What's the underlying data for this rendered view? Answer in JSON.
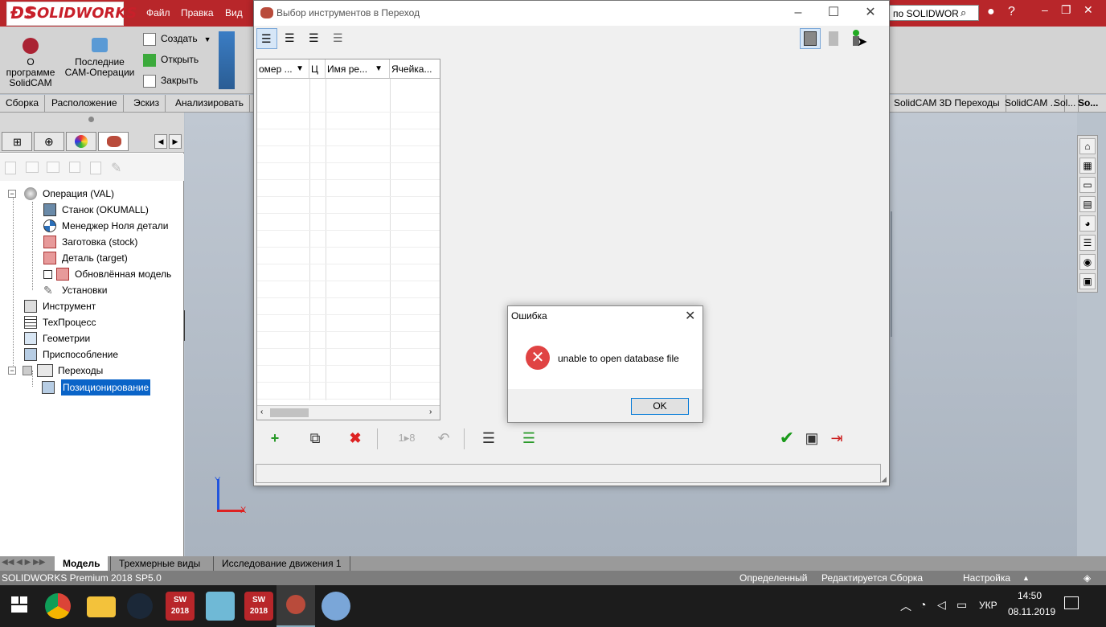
{
  "app": {
    "logo_text": "SOLIDWORKS",
    "menu": [
      "Файл",
      "Правка",
      "Вид"
    ],
    "search_text": "по SOLIDWOR",
    "brand_color": "#b8262a"
  },
  "ribbon": {
    "about_label": "О программе SolidCAM",
    "recent_label": "Последние CAM-Операции",
    "create_label": "Создать",
    "open_label": "Открыть",
    "close_label": "Закрыть"
  },
  "ribbon_tabs": [
    "Сборка",
    "Расположение",
    "Эскиз",
    "Анализировать"
  ],
  "ribbon_tabs_right": [
    "SolidCAM 3D Переходы",
    "SolidCAM ...",
    "Sol...",
    "So..."
  ],
  "tree": [
    {
      "label": "Операция (VAL)",
      "icon": "operation-icon"
    },
    {
      "label": "Станок (OKUMALL)",
      "icon": "machine-icon"
    },
    {
      "label": "Менеджер Ноля детали",
      "icon": "coordinate-icon"
    },
    {
      "label": "Заготовка (stock)",
      "icon": "stock-icon"
    },
    {
      "label": "Деталь (target)",
      "icon": "target-icon"
    },
    {
      "label": "Обновлённая модель",
      "icon": "model-icon"
    },
    {
      "label": "Установки",
      "icon": "settings-icon"
    },
    {
      "label": "Инструмент",
      "icon": "tool-icon"
    },
    {
      "label": "ТехПроцесс",
      "icon": "process-icon"
    },
    {
      "label": "Геометрии",
      "icon": "geometry-icon"
    },
    {
      "label": "Приспособление",
      "icon": "fixture-icon"
    },
    {
      "label": "Переходы",
      "icon": "folder-icon"
    },
    {
      "label": "Позиционирование",
      "icon": "position-icon"
    }
  ],
  "dialog": {
    "title": "Выбор инструментов в Переход",
    "columns": [
      "омер ...",
      "Ц",
      "Имя ре...",
      "Ячейка..."
    ]
  },
  "error": {
    "title": "Ошибка",
    "message": "unable to open database file",
    "ok_label": "OK"
  },
  "axes": {
    "y": "Y",
    "x": "X"
  },
  "bottom_tabs": [
    "Модель",
    "Трехмерные виды",
    "Исследование движения 1"
  ],
  "status": {
    "product": "SOLIDWORKS Premium 2018 SP5.0",
    "state1": "Определенный",
    "state2": "Редактируется Сборка",
    "settings": "Настройка"
  },
  "taskbar": {
    "language": "УКР",
    "time": "14:50",
    "date": "08.11.2019",
    "sw_label": "2018"
  }
}
